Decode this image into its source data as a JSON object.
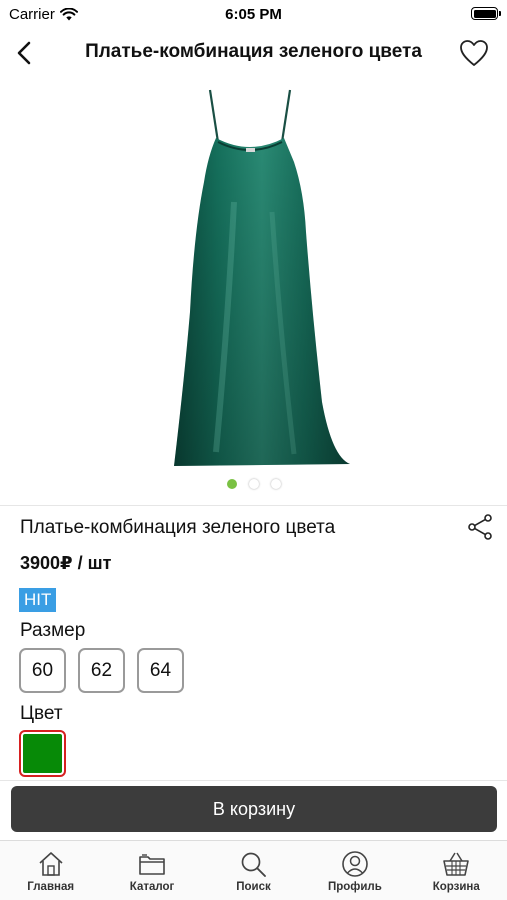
{
  "status_bar": {
    "carrier": "Carrier",
    "time": "6:05 PM",
    "icons": [
      "wifi-icon",
      "battery-icon"
    ]
  },
  "nav": {
    "title": "Платье-комбинация зеленого цвета",
    "back_icon": "chevron-left-icon",
    "favorite_icon": "heart-icon"
  },
  "gallery": {
    "image": "green-slip-dress",
    "page_count": 3,
    "active_page": 1,
    "active_dot_color": "#7ac143"
  },
  "product": {
    "name": "Платье-комбинация зеленого цвета",
    "price": "3900₽ / шт",
    "badge": "HIT",
    "badge_color": "#3a9ee4",
    "share_icon": "share-icon",
    "size_label": "Размер",
    "sizes": [
      "60",
      "62",
      "64"
    ],
    "color_label": "Цвет",
    "color_swatch": "#078a07",
    "selected_border_color": "#d62020"
  },
  "cart_button": {
    "label": "В корзину",
    "color": "#3c3c3c"
  },
  "tab_bar": {
    "tabs": [
      {
        "label": "Главная",
        "icon": "home-icon"
      },
      {
        "label": "Каталог",
        "icon": "folder-icon"
      },
      {
        "label": "Поиск",
        "icon": "search-icon"
      },
      {
        "label": "Профиль",
        "icon": "profile-icon"
      },
      {
        "label": "Корзина",
        "icon": "basket-icon"
      }
    ]
  }
}
